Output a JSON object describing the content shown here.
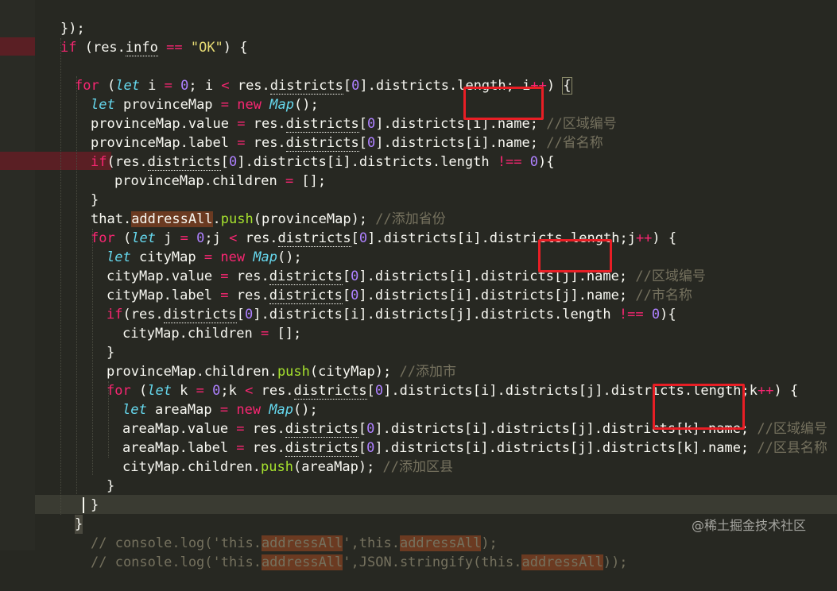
{
  "editor": {
    "watermark": "@稀土掘金技术社区",
    "lines": [
      "});",
      "if (res.info == \"OK\") {",
      "",
      "  for (let i = 0; i < res.districts[0].districts.length; i++) {",
      "    let provinceMap = new Map();",
      "    provinceMap.value = res.districts[0].districts[i].name; //区域编号",
      "    provinceMap.label = res.districts[0].districts[i].name; //省名称",
      "    if(res.districts[0].districts[i].districts.length !== 0){",
      "      provinceMap.children = [];",
      "    }",
      "    that.addressAll.push(provinceMap); //添加省份",
      "    for (let j = 0;j < res.districts[0].districts[i].districts.length;j++) {",
      "      let cityMap = new Map();",
      "      cityMap.value = res.districts[0].districts[i].districts[j].name; //区域编号",
      "      cityMap.label = res.districts[0].districts[i].districts[j].name; //市名称",
      "      if(res.districts[0].districts[i].districts[j].districts.length !== 0){",
      "        cityMap.children = [];",
      "      }",
      "      provinceMap.children.push(cityMap); //添加市",
      "      for (let k = 0;k < res.districts[0].districts[i].districts[j].districts.length;k++) {",
      "        let areaMap = new Map();",
      "        areaMap.value = res.districts[0].districts[i].districts[j].districts[k].name; //区域编号",
      "        areaMap.label = res.districts[0].districts[i].districts[j].districts[k].name; //区县名称",
      "        cityMap.children.push(areaMap); //添加区县",
      "      }",
      "    }",
      "  }",
      "    // console.log('this.addressAll',this.addressAll);",
      "    // console.log('this.addressAll',JSON.stringify(this.addressAll));"
    ],
    "colors": {
      "background": "#272822",
      "keyword": "#f92672",
      "string": "#e6db74",
      "number": "#ae81ff",
      "type": "#66d9ef",
      "function": "#a6e22e",
      "comment": "#75715e",
      "annotation_box": "#e81e25"
    }
  }
}
